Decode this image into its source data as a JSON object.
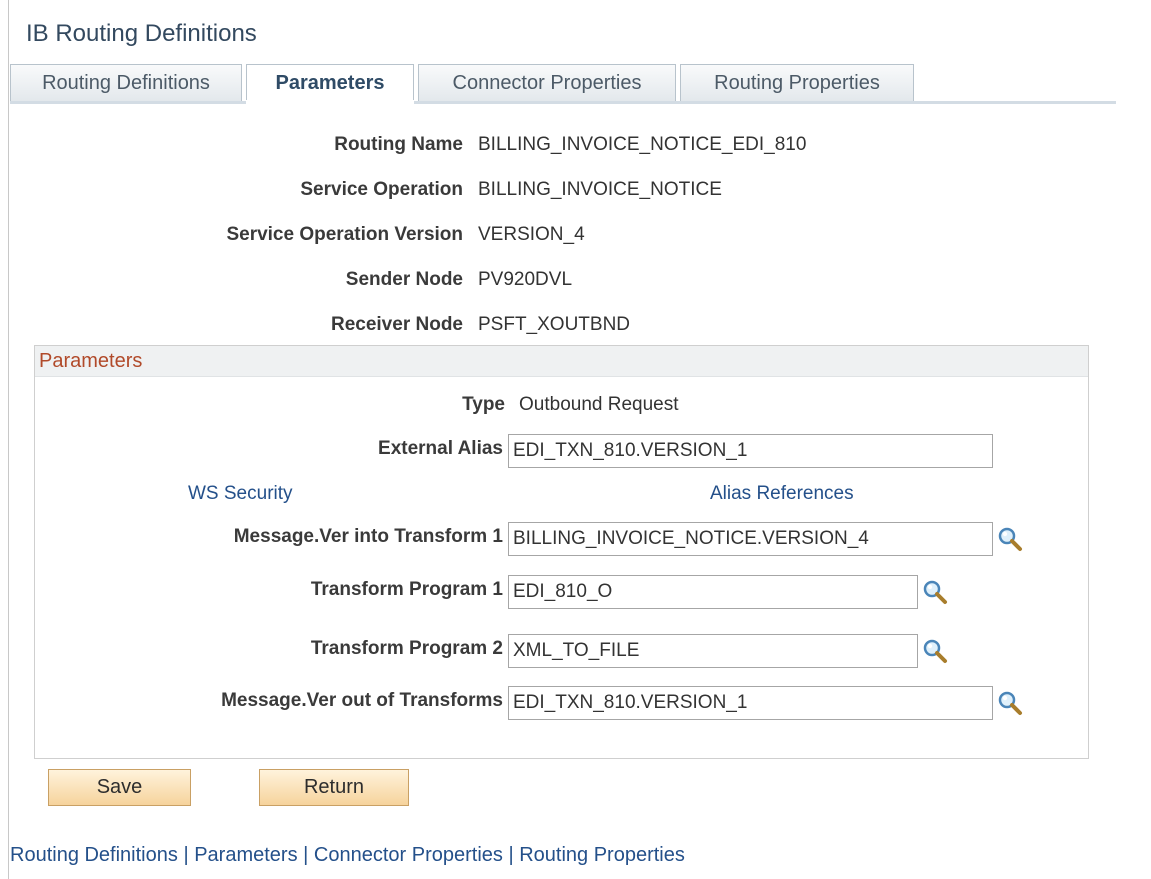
{
  "page": {
    "title": "IB Routing Definitions"
  },
  "tabs": [
    {
      "label": "Routing Definitions"
    },
    {
      "label": "Parameters"
    },
    {
      "label": "Connector Properties"
    },
    {
      "label": "Routing Properties"
    }
  ],
  "fields": {
    "routing_name": {
      "label": "Routing Name",
      "value": "BILLING_INVOICE_NOTICE_EDI_810"
    },
    "service_operation": {
      "label": "Service Operation",
      "value": "BILLING_INVOICE_NOTICE"
    },
    "service_operation_version": {
      "label": "Service Operation Version",
      "value": "VERSION_4"
    },
    "sender_node": {
      "label": "Sender Node",
      "value": "PV920DVL"
    },
    "receiver_node": {
      "label": "Receiver Node",
      "value": "PSFT_XOUTBND"
    }
  },
  "parameters": {
    "title": "Parameters",
    "type": {
      "label": "Type",
      "value": "Outbound Request"
    },
    "external_alias": {
      "label": "External Alias",
      "value": "EDI_TXN_810.VERSION_1"
    },
    "ws_security_link": "WS Security",
    "alias_references_link": "Alias References",
    "msg_into_transform": {
      "label": "Message.Ver into Transform 1",
      "value": "BILLING_INVOICE_NOTICE.VERSION_4"
    },
    "transform_program_1": {
      "label": "Transform Program 1",
      "value": "EDI_810_O"
    },
    "transform_program_2": {
      "label": "Transform Program 2",
      "value": "XML_TO_FILE"
    },
    "msg_out_of_transforms": {
      "label": "Message.Ver out of Transforms",
      "value": "EDI_TXN_810.VERSION_1"
    }
  },
  "buttons": {
    "save": "Save",
    "return": "Return"
  },
  "footer_links": [
    "Routing Definitions",
    "Parameters",
    "Connector Properties",
    "Routing Properties"
  ],
  "footer_separator": "|",
  "icons": {
    "lookup": "magnifying-glass-icon"
  },
  "colors": {
    "group_title": "#b14a2a",
    "link": "#24508a",
    "button_bg": "#f6d39c"
  }
}
